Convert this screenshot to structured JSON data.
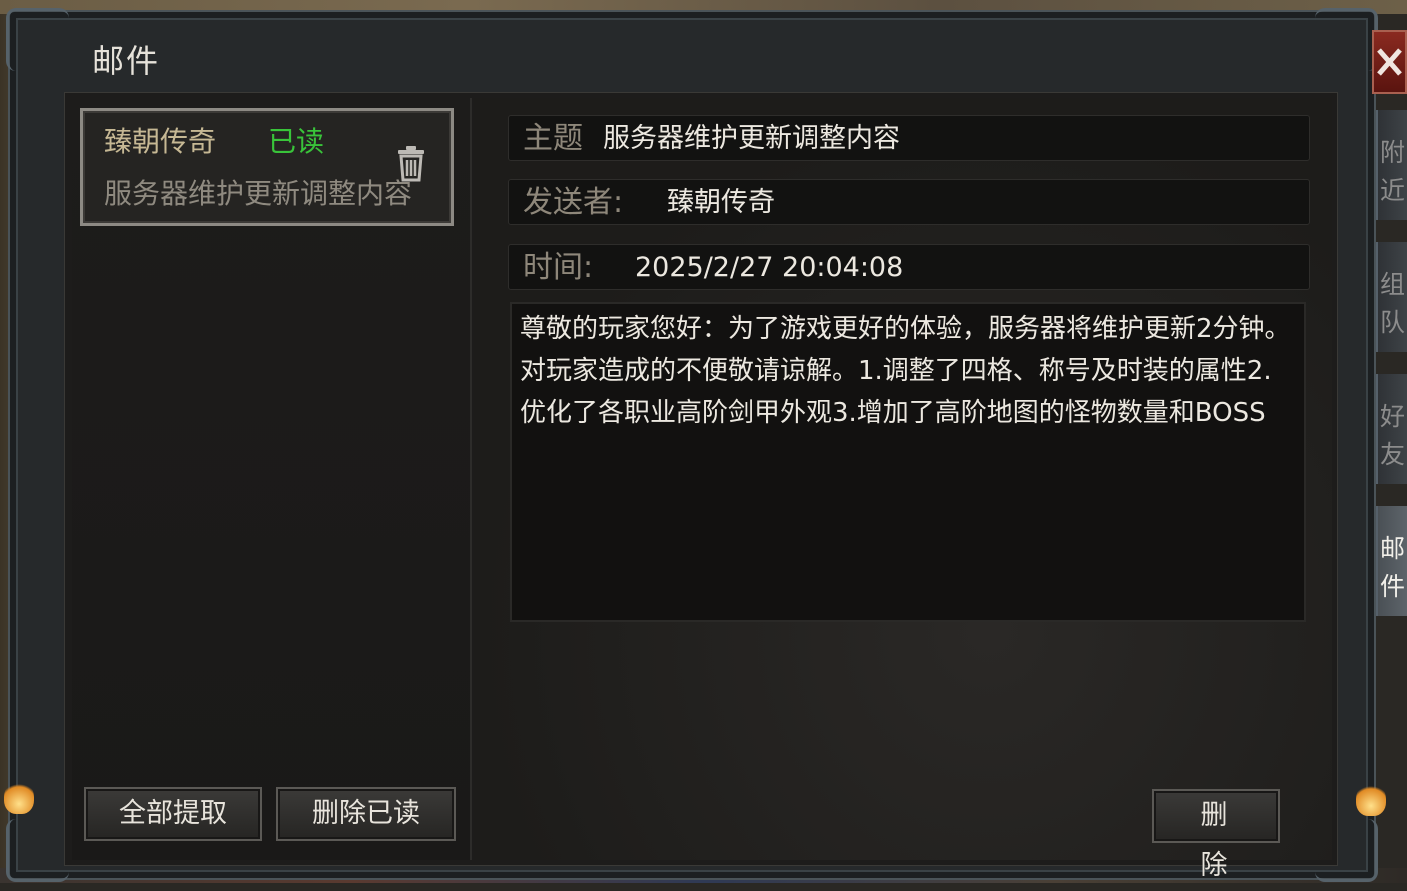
{
  "window": {
    "title": "邮件",
    "close_icon": "close-icon"
  },
  "mail_list": {
    "items": [
      {
        "sender": "臻朝传奇",
        "status": "已读",
        "status_color": "#39c43a",
        "subject": "服务器维护更新调整内容",
        "delete_icon": "trash-icon"
      }
    ],
    "buttons": {
      "collect_all": "全部提取",
      "delete_read": "删除已读"
    }
  },
  "mail_detail": {
    "subject_label": "主题",
    "subject": "服务器维护更新调整内容",
    "sender_label": "发送者:",
    "sender": "臻朝传奇",
    "time_label": "时间:",
    "time": "2025/2/27 20:04:08",
    "body": "尊敬的玩家您好：为了游戏更好的体验，服务器将维护更新2分钟。对玩家造成的不便敬请谅解。1.调整了四格、称号及时装的属性2.优化了各职业高阶剑甲外观3.增加了高阶地图的怪物数量和BOSS",
    "delete_button": "删 除"
  },
  "side_tabs": [
    {
      "label": "附近",
      "active": false
    },
    {
      "label": "组队",
      "active": false
    },
    {
      "label": "好友",
      "active": false
    },
    {
      "label": "邮件",
      "active": true
    }
  ]
}
